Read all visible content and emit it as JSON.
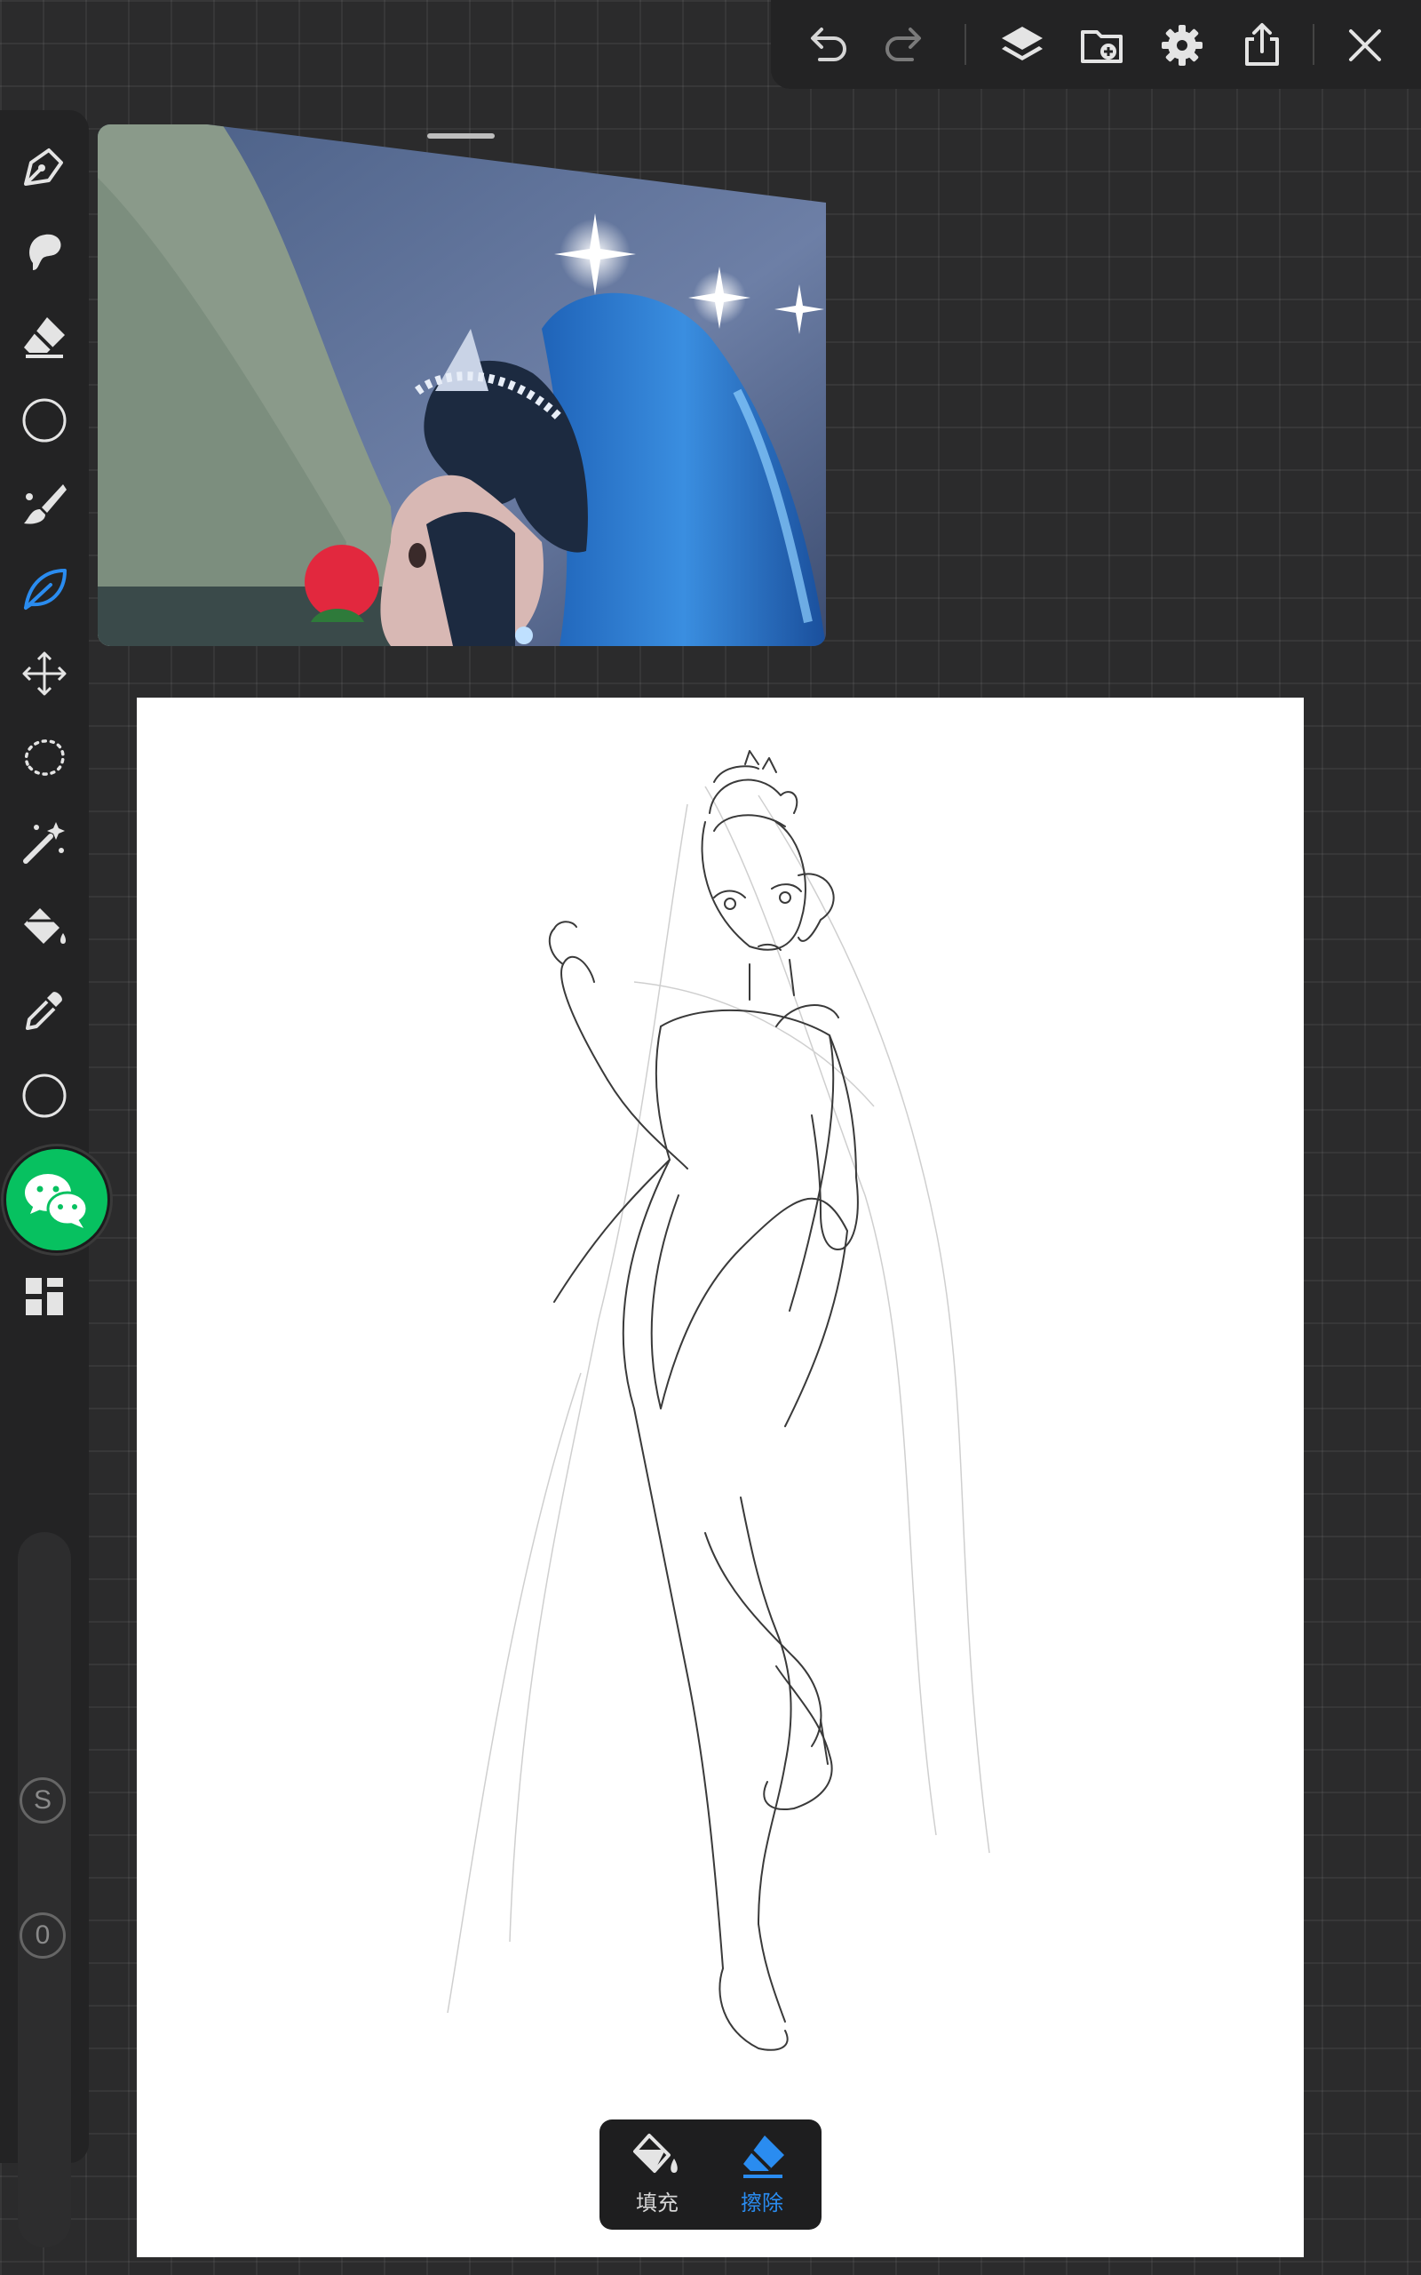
{
  "top_toolbar": {
    "buttons": [
      "undo-icon",
      "redo-icon",
      "layers-icon",
      "import-icon",
      "settings-icon",
      "share-icon",
      "close-icon"
    ]
  },
  "left_toolbar": {
    "tools": [
      "pen-icon",
      "smudge-icon",
      "eraser-icon",
      "color-circle",
      "brush-icon",
      "leaf-brush-icon",
      "transform-icon",
      "lasso-icon",
      "magic-wand-icon",
      "fill-bucket-icon",
      "eyedropper-icon",
      "color-circle",
      "grid-icon"
    ],
    "active_tool": "leaf-brush-icon",
    "accent_color": "#2a8cf0",
    "size_badge": "S",
    "opacity_badge": "0"
  },
  "floating_app": {
    "icon": "wechat-icon",
    "color": "#07c160"
  },
  "popup": {
    "fill_label": "填充",
    "erase_label": "擦除",
    "active": "erase"
  }
}
